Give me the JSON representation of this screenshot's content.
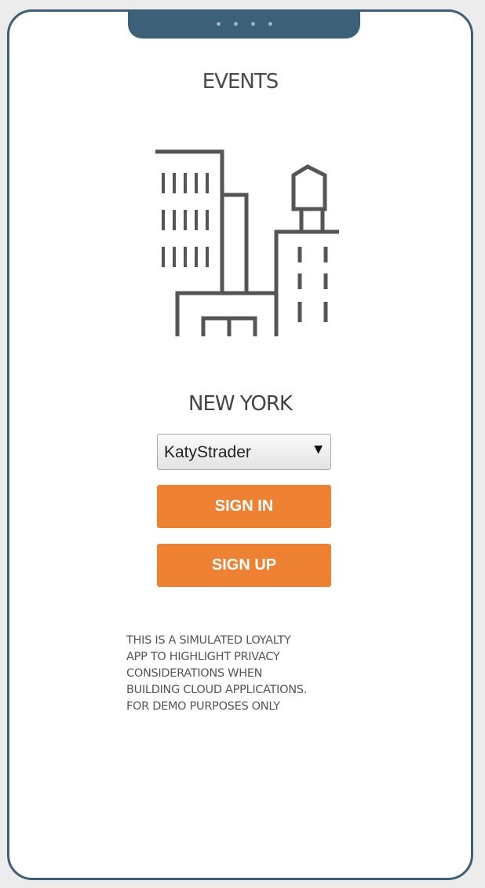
{
  "app": {
    "title": "EVENTS",
    "city_name": "NEW YORK",
    "city_illustration_icon": "city-skyline-water-tower-icon"
  },
  "user_select": {
    "selected": "KatyStrader",
    "arrow": "▼"
  },
  "buttons": {
    "sign_in": "SIGN IN",
    "sign_up": "SIGN UP"
  },
  "disclaimer": {
    "lines": [
      "THIS IS A SIMULATED LOYALTY",
      "APP TO HIGHLIGHT PRIVACY",
      "CONSIDERATIONS WHEN",
      "BUILDING CLOUD APPLICATIONS.",
      "FOR DEMO PURPOSES ONLY"
    ]
  },
  "colors": {
    "frame": "#3b6078",
    "accent_button": "#ef8232",
    "text": "#4a4a4a",
    "background": "#ffffff"
  }
}
